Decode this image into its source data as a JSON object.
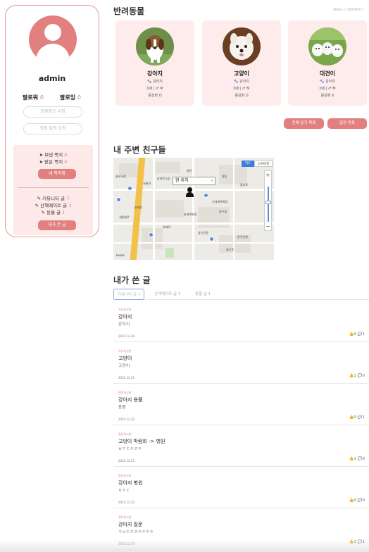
{
  "profile": {
    "username": "admin",
    "followers_label": "팔로워",
    "followers_count": "0",
    "following_label": "팔로잉",
    "following_count": "0",
    "edit_info_label": "회원정보 수정",
    "delete_account_label": "회원 탈퇴 요청",
    "sent_messages_label": "보낸 쪽지",
    "sent_messages_count": "0",
    "received_messages_label": "받은 쪽지",
    "received_messages_count": "0",
    "my_messages_button": "내 쪽지함",
    "community_posts_label": "커뮤니티 글",
    "community_posts_count": "7",
    "walkmate_posts_label": "산책메이트 글",
    "walkmate_posts_count": "3",
    "album_posts_label": "동물 글",
    "album_posts_count": "1",
    "my_posts_button": "내가 쓴 글"
  },
  "pets": {
    "title": "반려동물",
    "top_link": "회원님 스크랩목록보기",
    "items": [
      {
        "name": "강아지",
        "breed": "강아지",
        "age_gender": "0세 | ♂ M",
        "neutered": "중성화 O",
        "photo": "beagle"
      },
      {
        "name": "고양이",
        "breed": "강아지",
        "age_gender": "0세 | ♂ M",
        "neutered": "중성화 O",
        "photo": "white-dog"
      },
      {
        "name": "대견이",
        "breed": "강아지",
        "age_gender": "0세 | ♂ M",
        "neutered": "중성화 X",
        "photo": "puppies"
      }
    ],
    "diary_list_button": "전체 일기 목록",
    "diary_add_button": "일정 등록"
  },
  "map": {
    "title": "내 주변 친구들",
    "location_label": "현 위치",
    "type_map": "지도",
    "type_skyview": "스카이뷰",
    "zoom_in": "+",
    "zoom_out": "−",
    "labels": [
      "용산구청",
      "서울역",
      "남대문시장",
      "숭례문",
      "명동",
      "회현",
      "을지로",
      "중구청",
      "신세계백화점",
      "남산공원",
      "퇴계로",
      "세종대로",
      "한국은행",
      "롯데백화점",
      "충무로"
    ],
    "attribution": "kakao"
  },
  "posts": {
    "title": "내가 쓴 글",
    "tabs": [
      {
        "label": "커뮤니티 글",
        "count": "7"
      },
      {
        "label": "산책메이트 글",
        "count": "3"
      },
      {
        "label": "동물 글",
        "count": "1"
      }
    ],
    "items": [
      {
        "category": "자유게시판",
        "title": "강아지",
        "body": "강아지",
        "date": "2022.12.24",
        "likes": "0",
        "comments": "1"
      },
      {
        "category": "자유게시판",
        "title": "고양이",
        "body": "고양이",
        "date": "2022.12.24",
        "likes": "1",
        "comments": "0"
      },
      {
        "category": "질문게시판",
        "title": "강아지 용품",
        "body": "용품",
        "date": "2022.12.23",
        "likes": "0",
        "comments": "1"
      },
      {
        "category": "질문게시판",
        "title": "고양이 박람회 -> 병원",
        "body": "ㅂㅈㄷㅇㄹㅇ",
        "date": "2022.12.23",
        "likes": "1",
        "comments": "0"
      },
      {
        "category": "질문게시판",
        "title": "강아지 병원",
        "body": "ㅂㅈㄷ",
        "date": "2022.12.23",
        "likes": "0",
        "comments": "0"
      },
      {
        "category": "정보게시판",
        "title": "강아지 질문",
        "body": "ㅈㅂㄷㅇㄹㅇㅇㅇㅇ",
        "date": "2022.12.23",
        "likes": "1",
        "comments": "1"
      }
    ]
  }
}
